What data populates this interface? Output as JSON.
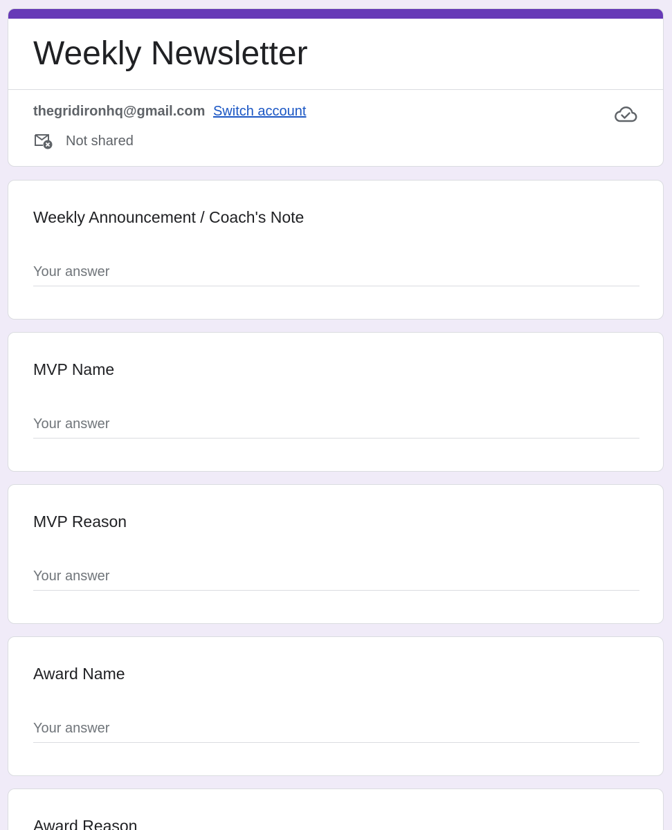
{
  "form": {
    "title": "Weekly Newsletter",
    "accent_color": "#673ab7",
    "background_color": "#f0ebf8"
  },
  "account": {
    "email": "thegridironhq@gmail.com",
    "switch_label": "Switch account",
    "shared_status": "Not shared",
    "shared_icon": "mail-not-shared-icon",
    "save_icon": "cloud-saved-icon"
  },
  "questions": [
    {
      "label": "Weekly Announcement / Coach's Note",
      "placeholder": "Your answer",
      "value": ""
    },
    {
      "label": "MVP Name",
      "placeholder": "Your answer",
      "value": ""
    },
    {
      "label": "MVP Reason",
      "placeholder": "Your answer",
      "value": ""
    },
    {
      "label": "Award Name",
      "placeholder": "Your answer",
      "value": ""
    },
    {
      "label": "Award Reason"
    }
  ]
}
